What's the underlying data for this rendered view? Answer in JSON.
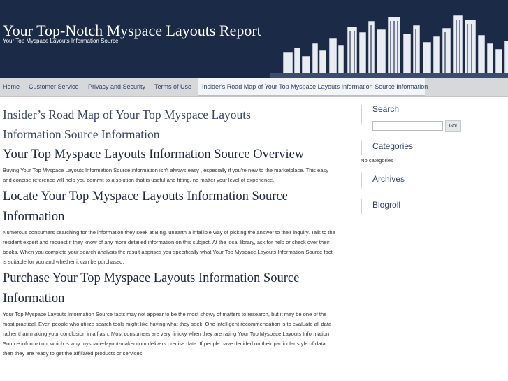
{
  "header": {
    "title": "Your Top-Notch Myspace Layouts Report",
    "tagline": "Your Top Myspace Layouts Information Source"
  },
  "nav": {
    "items": [
      {
        "label": "Home"
      },
      {
        "label": "Customer Service"
      },
      {
        "label": "Privacy and Security"
      },
      {
        "label": "Terms of Use"
      },
      {
        "label": "Insider's Road Map of Your Top Myspace Layouts Information Source Information"
      }
    ]
  },
  "main": {
    "page_title_line1": "Insider’s Road Map of Your Top Myspace Layouts",
    "page_title_line2": "Information Source Information",
    "sections": [
      {
        "heading": "Your Top Myspace Layouts Information Source Overview",
        "text": "Buying Your Top Myspace Layouts Information Source information isn't always easy , especially if you're new to the marketplace. This easy and concise reference will help you commit to a solution that is useful and fitting, no matter your level of experience."
      },
      {
        "heading": "Locate Your Top Myspace Layouts Information Source Information",
        "text": "Numerous consumers searching for the information they seek at Bing. unearth a infallible way of picking the answer to their inquiry. Talk to the resident expert and request if they know of any more detailed information on this subject. At the local library, ask for help or check over their books. When you complete your search analysis the result apprises you specifically what Your Top Myspace Layouts Information Source fact is suitable for you and whether it can be purchased."
      },
      {
        "heading": "Purchase Your Top Myspace Layouts Information Source Information",
        "text": "Your Top Myspace Layouts Information Source facts may not appear to be the most showy of matters to research, but it may be one of the most practical. Even people who utilize search tools might like having what they seek. One intelligent recommendation is to evaluate all data rather than making your conclusion in a flash. Most consumers are very finicky when they are rating Your Top Myspace Layouts Information Source information, which is why myspace-layout-maker.com delivers precise data. If people have decided on their particular style of data, then they are ready to get the affiliated products or services."
      }
    ]
  },
  "sidebar": {
    "search_title": "Search",
    "search_value": "",
    "search_button": "Go!",
    "categories_title": "Categories",
    "no_categories": "No categories",
    "archives_title": "Archives",
    "blogroll_title": "Blogroll"
  },
  "colors": {
    "header_bg": "#1b2a46",
    "nav_bg": "#d6d8da",
    "link": "#2a3f6a",
    "heading": "#1d2740"
  }
}
